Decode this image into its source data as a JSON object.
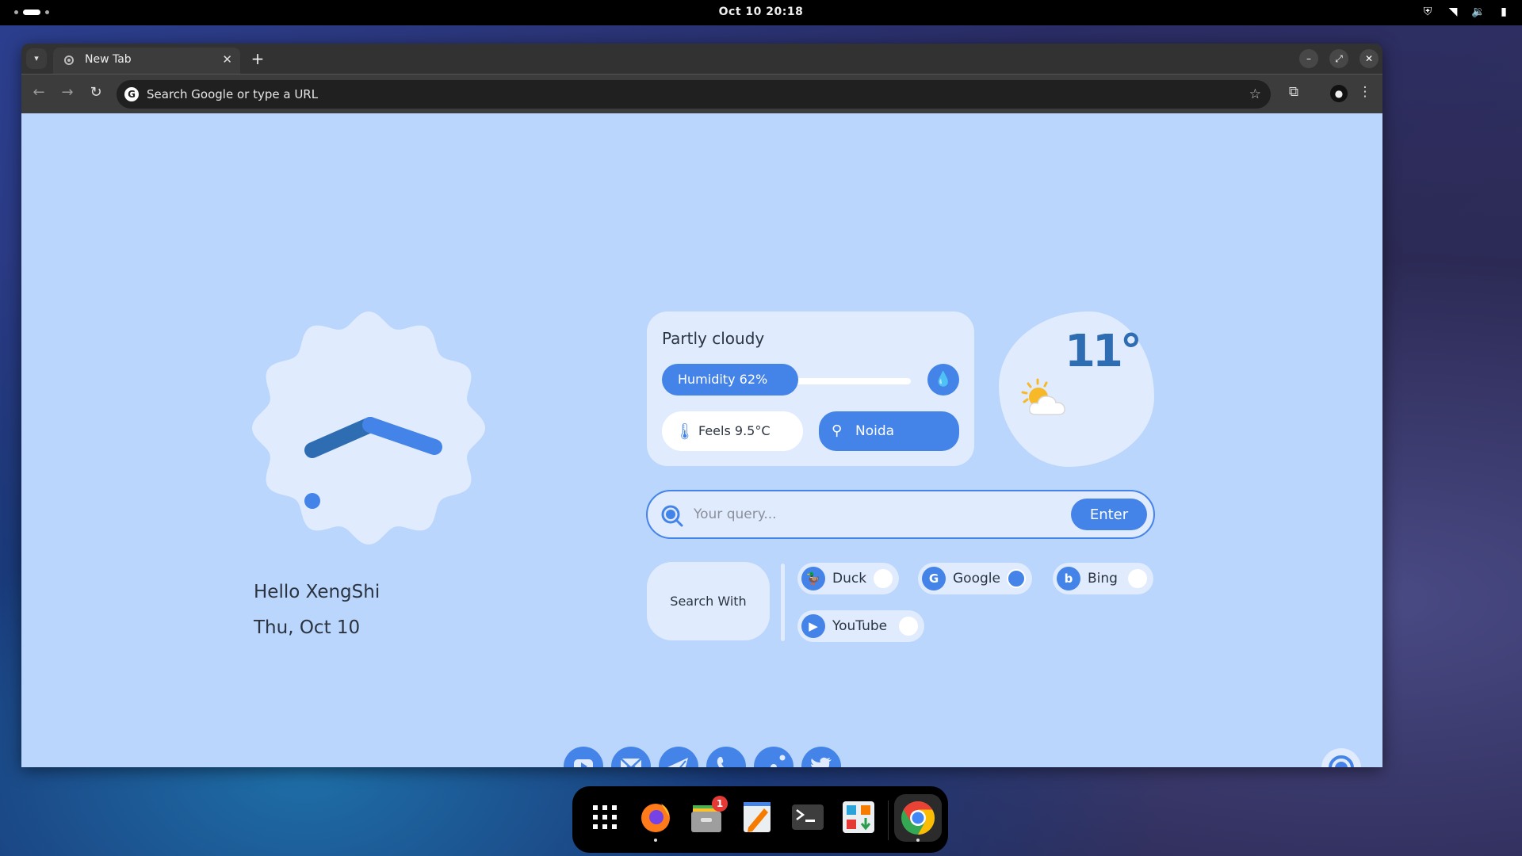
{
  "topbar": {
    "datetime": "Oct 10  20:18",
    "tray_icons": [
      "shield-icon",
      "wifi-icon",
      "volume-icon",
      "battery-icon"
    ]
  },
  "browser": {
    "tab_title": "New Tab",
    "new_tab_label": "+",
    "omnibox_placeholder": "Search Google or type a URL",
    "window_controls": [
      "minimize",
      "maximize",
      "close"
    ]
  },
  "page": {
    "greeting": "Hello XengShi",
    "date": "Thu, Oct 10",
    "clock": {
      "hour": 20,
      "minute": 18
    },
    "weather": {
      "condition": "Partly cloudy",
      "humidity_label": "Humidity 62%",
      "humidity_percent": 62,
      "feels_label": "Feels 9.5°C",
      "location": "Noida",
      "temperature": "11°"
    },
    "search": {
      "placeholder": "Your query...",
      "value": "",
      "enter_label": "Enter"
    },
    "search_with_label": "Search With",
    "engines": [
      {
        "name": "Duck",
        "selected": false,
        "icon": "duck-icon"
      },
      {
        "name": "Google",
        "selected": true,
        "icon": "google-icon"
      },
      {
        "name": "Bing",
        "selected": false,
        "icon": "bing-icon"
      },
      {
        "name": "YouTube",
        "selected": false,
        "icon": "youtube-icon"
      }
    ],
    "shortcuts": [
      "youtube-icon",
      "mail-icon",
      "telegram-icon",
      "whatsapp-icon",
      "reddit-icon",
      "twitter-icon"
    ],
    "accent_color": "#4483e8",
    "background_color": "#bad6fc",
    "card_color": "#e0ecfe"
  },
  "dock": {
    "apps": [
      "app-grid",
      "firefox",
      "files",
      "text-editor",
      "terminal",
      "software-store",
      "chrome"
    ],
    "files_badge": "1"
  }
}
